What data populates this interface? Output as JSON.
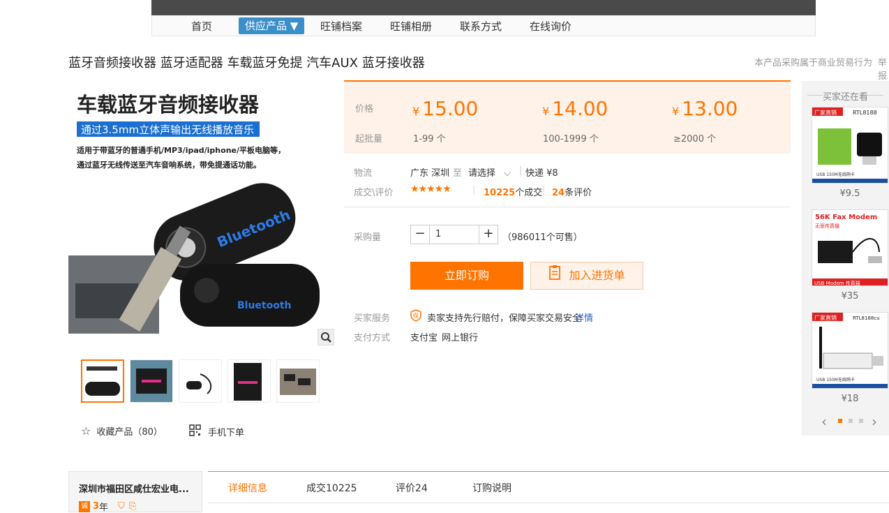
{
  "nav": {
    "items": [
      "首页",
      "供应产品 ▼",
      "旺铺档案",
      "旺铺相册",
      "联系方式",
      "在线询价"
    ]
  },
  "product": {
    "title": "蓝牙音频接收器 蓝牙适配器 车载蓝牙免提 汽车AUX 蓝牙接收器",
    "trade_note": "本产品采购属于商业贸易行为",
    "report": "举报",
    "image_text": {
      "headline": "车载蓝牙音频接收器",
      "banner": "通过3.5mm立体声输出无线播放音乐",
      "line1": "适用于带蓝牙的普通手机/MP3/ipad/iphone/平板电脑等，",
      "line2": "通过蓝牙无线传送至汽车音响系统，带免提通话功能。",
      "brand": "Bluetooth"
    }
  },
  "pricing": {
    "price_label": "价格",
    "moq_label": "起批量",
    "currency": "¥",
    "tiers": [
      {
        "price": "15.00",
        "range": "1-99 个"
      },
      {
        "price": "14.00",
        "range": "100-1999 个"
      },
      {
        "price": "13.00",
        "range": "≥2000 个"
      }
    ]
  },
  "logistics": {
    "label": "物流",
    "from": "广东 深圳",
    "to_word": "至",
    "dest": "请选择",
    "express": "快递 ¥8"
  },
  "trade": {
    "label": "成交\\评价",
    "stars": "★★★★★",
    "deals_num": "10225",
    "deals_text": "个成交",
    "reviews_num": "24",
    "reviews_text": "条评价"
  },
  "purchase": {
    "label": "采购量",
    "qty": "1",
    "minus": "−",
    "plus": "+",
    "available": "（986011个可售）"
  },
  "actions": {
    "buy": "立即订购",
    "cart": "加入进货单"
  },
  "service": {
    "label": "买家服务",
    "text": "卖家支持先行赔付，保障买家交易安全",
    "link": "详情"
  },
  "payment": {
    "label": "支付方式",
    "methods": [
      "支付宝",
      "网上银行"
    ]
  },
  "gallery": {
    "favorite": "收藏产品（80）",
    "mobile": "手机下单"
  },
  "sidebar": {
    "title": "买家还在看",
    "items": [
      {
        "price": "¥9.5",
        "tag": "厂家直销",
        "model": "RTL8188",
        "caption": "USB 150M无线网卡"
      },
      {
        "price": "¥35",
        "tag": "56K Fax Modem",
        "model": "无驱传真猫",
        "caption": "USB Modem 传真猫"
      },
      {
        "price": "¥18",
        "tag": "厂家直销",
        "model": "RTL8188cu",
        "caption": "USB 150M无线网卡"
      }
    ]
  },
  "shop": {
    "name": "深圳市福田区咸仕宏业电...",
    "years": "3",
    "years_unit": "年"
  },
  "tabs": [
    "详细信息",
    "成交10225",
    "评价24",
    "订购说明"
  ]
}
